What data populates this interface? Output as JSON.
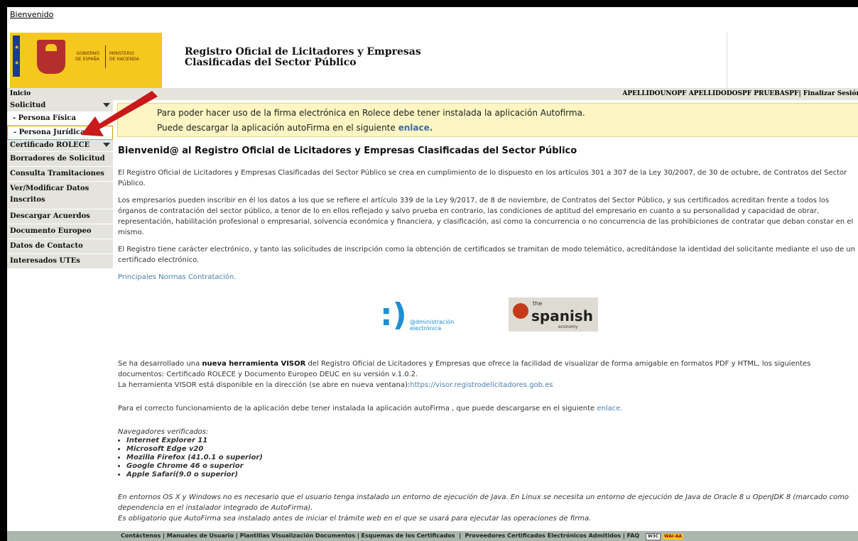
{
  "topbar": {
    "bienvenido": "Bienvenido"
  },
  "header": {
    "gobierno": "GOBIERNO\nDE ESPAÑA",
    "ministerio": "MINISTERIO\nDE HACIENDA",
    "title_line1": "Registro Oficial de Licitadores y Empresas",
    "title_line2": "Clasificadas del Sector Público"
  },
  "navbar": {
    "inicio": "Inicio",
    "user": "APELLIDOUNOPF APELLIDODOSPF PRUEBASPF",
    "logout": "Finalizar Sesión"
  },
  "sidebar": {
    "solicitud": "Solicitud",
    "persona_fisica": "- Persona Física",
    "persona_juridica": "- Persona Jurídica",
    "certificado": "Certificado ROLECE",
    "borradores": "Borradores de Solicitud",
    "consulta": "Consulta Tramitaciones",
    "ver_modificar": "Ver/Modificar Datos Inscritos",
    "descargar": "Descargar Acuerdos",
    "deuc": "Documento Europeo DEUC",
    "contacto": "Datos de Contacto",
    "utes": "Interesados UTEs"
  },
  "notice": {
    "line1": "Para poder hacer uso de la firma electrónica en Rolece debe tener instalada la aplicación Autofirma.",
    "line2": "Puede descargar la aplicación autoFirma en el siguiente",
    "link": "enlace."
  },
  "main": {
    "title": "Bienvenid@ al Registro Oficial de Licitadores y Empresas Clasificadas del Sector Público",
    "p1": "El Registro Oficial de Licitadores y Empresas Clasificadas del Sector Público se crea en cumplimiento de lo dispuesto en los artículos 301 a 307 de la Ley 30/2007, de 30 de octubre, de Contratos del Sector Público.",
    "p2": "Los empresarios pueden inscribir en él los datos a los que se refiere el artículo 339 de la Ley 9/2017, de 8 de noviembre, de Contratos del Sector Público, y sus certificados acreditan frente a todos los órganos de contratación del sector público, a tenor de lo en ellos reflejado y salvo prueba en contrario, las condiciones de aptitud del empresario en cuanto a su personalidad y capacidad de obrar, representación, habilitación profesional o empresarial, solvencia económica y financiera, y clasificación, así como la concurrencia o no concurrencia de las prohibiciones de contratar que deban constar en el mismo.",
    "p3": "El Registro tiene carácter electrónico, y tanto las solicitudes de inscripción como la obtención de certificados se tramitan de modo telemático, acreditándose la identidad del solicitante mediante el uso de un certificado electrónico.",
    "normas_link": "Principales Normas Contratación.",
    "admin_logo_text": "@dministración\nelectrónica",
    "spanish_the": "the",
    "spanish_word": "spanish",
    "spanish_eco": "economy",
    "visor_a": "Se ha desarrollado una ",
    "visor_b": "nueva herramienta VISOR",
    "visor_c": " del Registro Oficial de Licitadores y Empresas que ofrece la facilidad de visualizar de forma amigable en formatos PDF y HTML, los siguientes documentos: Certificado ROLECE y Documento Europeo DEUC en su versión v.1.0.2.",
    "visor_d": "La herramienta VISOR está disponible en la dirección (se abre en nueva ventana):",
    "visor_link": "https://visor.registrodelicitadores.gob.es",
    "autofirma_text": "Para el correcto funcionamiento de la aplicación debe tener instalada la aplicación autoFirma , que puede descargarse en el siguiente ",
    "autofirma_link": "enlace.",
    "nav_title": "Navegadores verificados:",
    "browsers": [
      "Internet Explorer 11",
      "Microsoft Edge v20",
      "Mozilla Firefox (41.0.1 o superior)",
      "Google Chrome 46 o superior",
      "Apple Safari(9.0 o superior)"
    ],
    "java1": "En entornos OS X y Windows no es necesario que el usuario tenga instalado un entorno de ejecución de Java. En Linux se necesita un entorno de ejecución de Java de Oracle 8 u OpenJDK 8 (marcado como dependencia en el instalador integrado de AutoFirma).",
    "java2": "Es obligatorio que AutoFirma sea instalado antes de iniciar el trámite web en el que se usará para ejecutar las operaciones de firma."
  },
  "footer": {
    "contactenos": "Contáctenos",
    "manuales": "Manuales de Usuario",
    "plantillas": "Plantillas Visualización Documentos",
    "esquemas": "Esquemas de los Certificados",
    "proveedores": "Proveedores Certificados Electrónicos Admitidos",
    "faq": "FAQ",
    "w3c": "W3C",
    "wai": "WAI-AA"
  },
  "colors": {
    "accent": "#f4c81f",
    "sidebar_bg": "#e4e4dc",
    "notice_bg": "#fdf5c3",
    "link": "#4a7fb0",
    "footer_bg": "#aab7ad",
    "arrow": "#c8191b"
  }
}
